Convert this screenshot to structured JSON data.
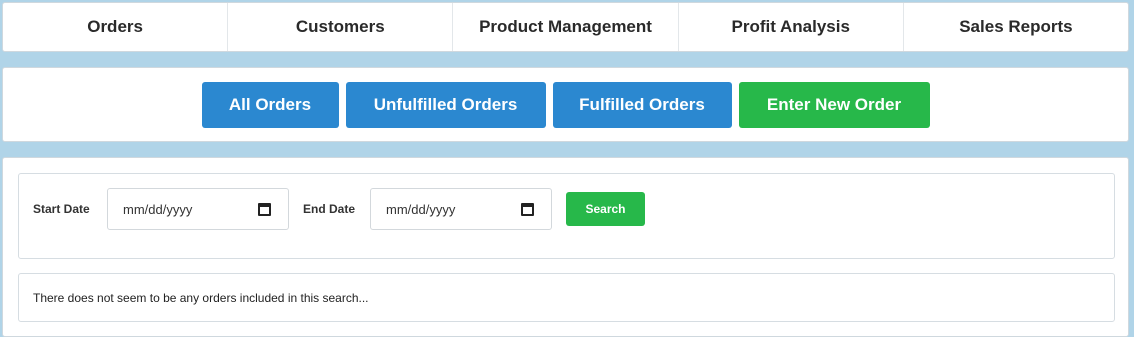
{
  "nav": {
    "items": [
      {
        "label": "Orders"
      },
      {
        "label": "Customers"
      },
      {
        "label": "Product Management"
      },
      {
        "label": "Profit Analysis"
      },
      {
        "label": "Sales Reports"
      }
    ]
  },
  "actions": {
    "all_orders": "All Orders",
    "unfulfilled_orders": "Unfulfilled Orders",
    "fulfilled_orders": "Fulfilled Orders",
    "enter_new_order": "Enter New Order"
  },
  "search": {
    "start_label": "Start Date",
    "start_placeholder": "mm/dd/yyyy",
    "end_label": "End Date",
    "end_placeholder": "mm/dd/yyyy",
    "button_label": "Search",
    "calendar_icon": "calendar-icon"
  },
  "results": {
    "message": "There does not seem to be any orders included in this search..."
  },
  "colors": {
    "background": "#b0d4e8",
    "primary_blue": "#2b88d0",
    "success_green": "#27b84a"
  }
}
